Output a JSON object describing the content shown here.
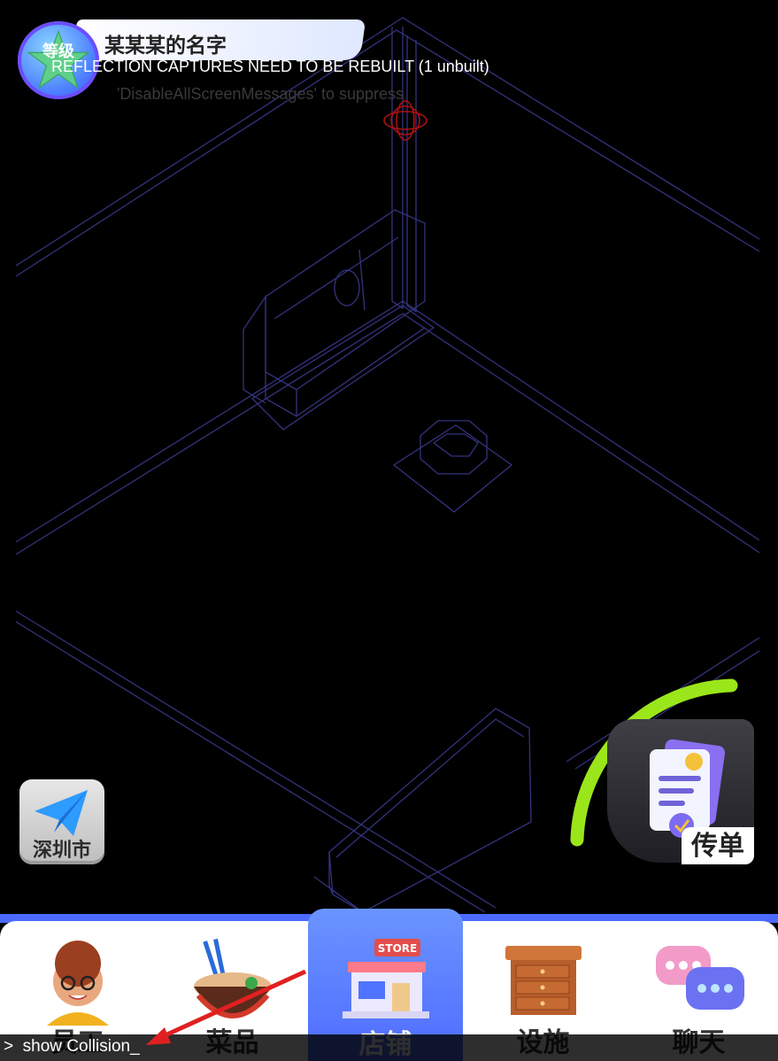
{
  "player": {
    "level_label": "等级",
    "name": "某某某的名字"
  },
  "debug": {
    "warning": "REFLECTION CAPTURES NEED TO BE REBUILT (1 unbuilt)",
    "hint": "'DisableAllScreenMessages' to suppress"
  },
  "city_button": {
    "label": "深圳市",
    "icon": "paper-plane-icon"
  },
  "flyer": {
    "label": "传单",
    "icon": "flyer-document-icon",
    "progress_color": "#9be61a"
  },
  "nav": {
    "items": [
      {
        "label": "员工",
        "icon": "employee-avatar-icon",
        "active": false
      },
      {
        "label": "菜品",
        "icon": "noodle-bowl-icon",
        "active": false
      },
      {
        "label": "店铺",
        "icon": "store-icon",
        "active": true,
        "badge": "STORE"
      },
      {
        "label": "设施",
        "icon": "cabinet-icon",
        "active": false
      },
      {
        "label": "聊天",
        "icon": "chat-bubbles-icon",
        "active": false
      }
    ]
  },
  "console": {
    "command": ">  show Collision_"
  },
  "colors": {
    "wireframe": "#3a3a8a",
    "nav_active": "#5b7cff",
    "annotation_arrow": "#e02020"
  }
}
